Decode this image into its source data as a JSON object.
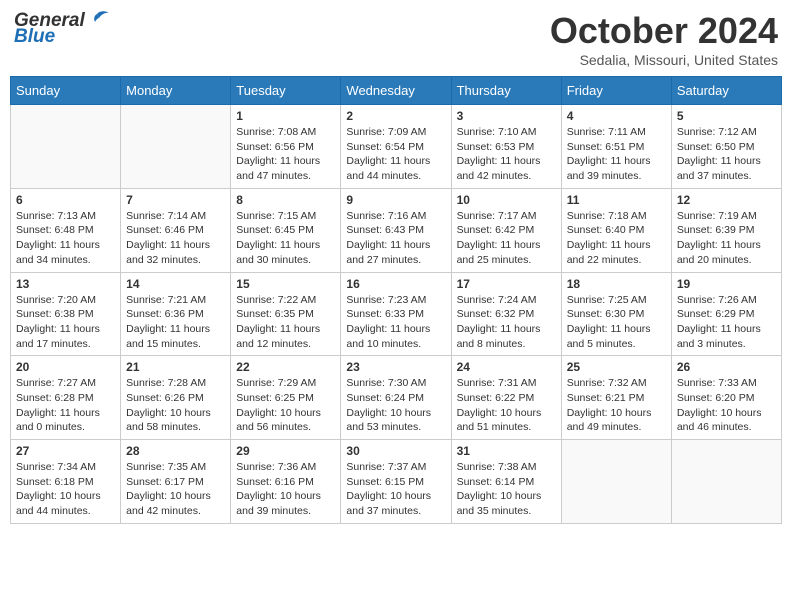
{
  "header": {
    "logo_general": "General",
    "logo_blue": "Blue",
    "month": "October 2024",
    "location": "Sedalia, Missouri, United States"
  },
  "weekdays": [
    "Sunday",
    "Monday",
    "Tuesday",
    "Wednesday",
    "Thursday",
    "Friday",
    "Saturday"
  ],
  "weeks": [
    [
      {
        "day": "",
        "info": ""
      },
      {
        "day": "",
        "info": ""
      },
      {
        "day": "1",
        "info": "Sunrise: 7:08 AM\nSunset: 6:56 PM\nDaylight: 11 hours and 47 minutes."
      },
      {
        "day": "2",
        "info": "Sunrise: 7:09 AM\nSunset: 6:54 PM\nDaylight: 11 hours and 44 minutes."
      },
      {
        "day": "3",
        "info": "Sunrise: 7:10 AM\nSunset: 6:53 PM\nDaylight: 11 hours and 42 minutes."
      },
      {
        "day": "4",
        "info": "Sunrise: 7:11 AM\nSunset: 6:51 PM\nDaylight: 11 hours and 39 minutes."
      },
      {
        "day": "5",
        "info": "Sunrise: 7:12 AM\nSunset: 6:50 PM\nDaylight: 11 hours and 37 minutes."
      }
    ],
    [
      {
        "day": "6",
        "info": "Sunrise: 7:13 AM\nSunset: 6:48 PM\nDaylight: 11 hours and 34 minutes."
      },
      {
        "day": "7",
        "info": "Sunrise: 7:14 AM\nSunset: 6:46 PM\nDaylight: 11 hours and 32 minutes."
      },
      {
        "day": "8",
        "info": "Sunrise: 7:15 AM\nSunset: 6:45 PM\nDaylight: 11 hours and 30 minutes."
      },
      {
        "day": "9",
        "info": "Sunrise: 7:16 AM\nSunset: 6:43 PM\nDaylight: 11 hours and 27 minutes."
      },
      {
        "day": "10",
        "info": "Sunrise: 7:17 AM\nSunset: 6:42 PM\nDaylight: 11 hours and 25 minutes."
      },
      {
        "day": "11",
        "info": "Sunrise: 7:18 AM\nSunset: 6:40 PM\nDaylight: 11 hours and 22 minutes."
      },
      {
        "day": "12",
        "info": "Sunrise: 7:19 AM\nSunset: 6:39 PM\nDaylight: 11 hours and 20 minutes."
      }
    ],
    [
      {
        "day": "13",
        "info": "Sunrise: 7:20 AM\nSunset: 6:38 PM\nDaylight: 11 hours and 17 minutes."
      },
      {
        "day": "14",
        "info": "Sunrise: 7:21 AM\nSunset: 6:36 PM\nDaylight: 11 hours and 15 minutes."
      },
      {
        "day": "15",
        "info": "Sunrise: 7:22 AM\nSunset: 6:35 PM\nDaylight: 11 hours and 12 minutes."
      },
      {
        "day": "16",
        "info": "Sunrise: 7:23 AM\nSunset: 6:33 PM\nDaylight: 11 hours and 10 minutes."
      },
      {
        "day": "17",
        "info": "Sunrise: 7:24 AM\nSunset: 6:32 PM\nDaylight: 11 hours and 8 minutes."
      },
      {
        "day": "18",
        "info": "Sunrise: 7:25 AM\nSunset: 6:30 PM\nDaylight: 11 hours and 5 minutes."
      },
      {
        "day": "19",
        "info": "Sunrise: 7:26 AM\nSunset: 6:29 PM\nDaylight: 11 hours and 3 minutes."
      }
    ],
    [
      {
        "day": "20",
        "info": "Sunrise: 7:27 AM\nSunset: 6:28 PM\nDaylight: 11 hours and 0 minutes."
      },
      {
        "day": "21",
        "info": "Sunrise: 7:28 AM\nSunset: 6:26 PM\nDaylight: 10 hours and 58 minutes."
      },
      {
        "day": "22",
        "info": "Sunrise: 7:29 AM\nSunset: 6:25 PM\nDaylight: 10 hours and 56 minutes."
      },
      {
        "day": "23",
        "info": "Sunrise: 7:30 AM\nSunset: 6:24 PM\nDaylight: 10 hours and 53 minutes."
      },
      {
        "day": "24",
        "info": "Sunrise: 7:31 AM\nSunset: 6:22 PM\nDaylight: 10 hours and 51 minutes."
      },
      {
        "day": "25",
        "info": "Sunrise: 7:32 AM\nSunset: 6:21 PM\nDaylight: 10 hours and 49 minutes."
      },
      {
        "day": "26",
        "info": "Sunrise: 7:33 AM\nSunset: 6:20 PM\nDaylight: 10 hours and 46 minutes."
      }
    ],
    [
      {
        "day": "27",
        "info": "Sunrise: 7:34 AM\nSunset: 6:18 PM\nDaylight: 10 hours and 44 minutes."
      },
      {
        "day": "28",
        "info": "Sunrise: 7:35 AM\nSunset: 6:17 PM\nDaylight: 10 hours and 42 minutes."
      },
      {
        "day": "29",
        "info": "Sunrise: 7:36 AM\nSunset: 6:16 PM\nDaylight: 10 hours and 39 minutes."
      },
      {
        "day": "30",
        "info": "Sunrise: 7:37 AM\nSunset: 6:15 PM\nDaylight: 10 hours and 37 minutes."
      },
      {
        "day": "31",
        "info": "Sunrise: 7:38 AM\nSunset: 6:14 PM\nDaylight: 10 hours and 35 minutes."
      },
      {
        "day": "",
        "info": ""
      },
      {
        "day": "",
        "info": ""
      }
    ]
  ]
}
